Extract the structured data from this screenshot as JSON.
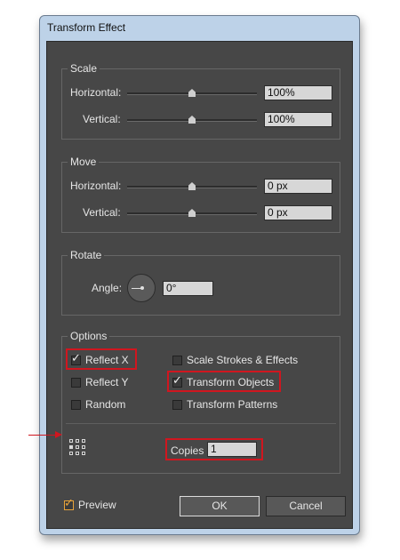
{
  "window": {
    "title": "Transform Effect"
  },
  "scale": {
    "legend": "Scale",
    "horizontal_label": "Horizontal:",
    "horizontal_value": "100%",
    "vertical_label": "Vertical:",
    "vertical_value": "100%"
  },
  "move": {
    "legend": "Move",
    "horizontal_label": "Horizontal:",
    "horizontal_value": "0 px",
    "vertical_label": "Vertical:",
    "vertical_value": "0 px"
  },
  "rotate": {
    "legend": "Rotate",
    "angle_label": "Angle:",
    "angle_value": "0°"
  },
  "options": {
    "legend": "Options",
    "reflect_x": {
      "label": "Reflect X",
      "checked": true
    },
    "reflect_y": {
      "label": "Reflect Y",
      "checked": false
    },
    "random": {
      "label": "Random",
      "checked": false
    },
    "scale_strokes": {
      "label": "Scale Strokes & Effects",
      "checked": false
    },
    "transform_objects": {
      "label": "Transform Objects",
      "checked": true
    },
    "transform_patterns": {
      "label": "Transform Patterns",
      "checked": false
    },
    "copies_label": "Copies",
    "copies_value": "1"
  },
  "footer": {
    "preview_label": "Preview",
    "preview_checked": true,
    "ok_label": "OK",
    "cancel_label": "Cancel"
  },
  "colors": {
    "dialog_bg": "#474747",
    "highlight": "#d0161f",
    "preview_check": "#e8a33a"
  },
  "icons": [
    "checkmark-icon",
    "reference-point-icon",
    "arrow-right-icon",
    "angle-dial-icon"
  ]
}
